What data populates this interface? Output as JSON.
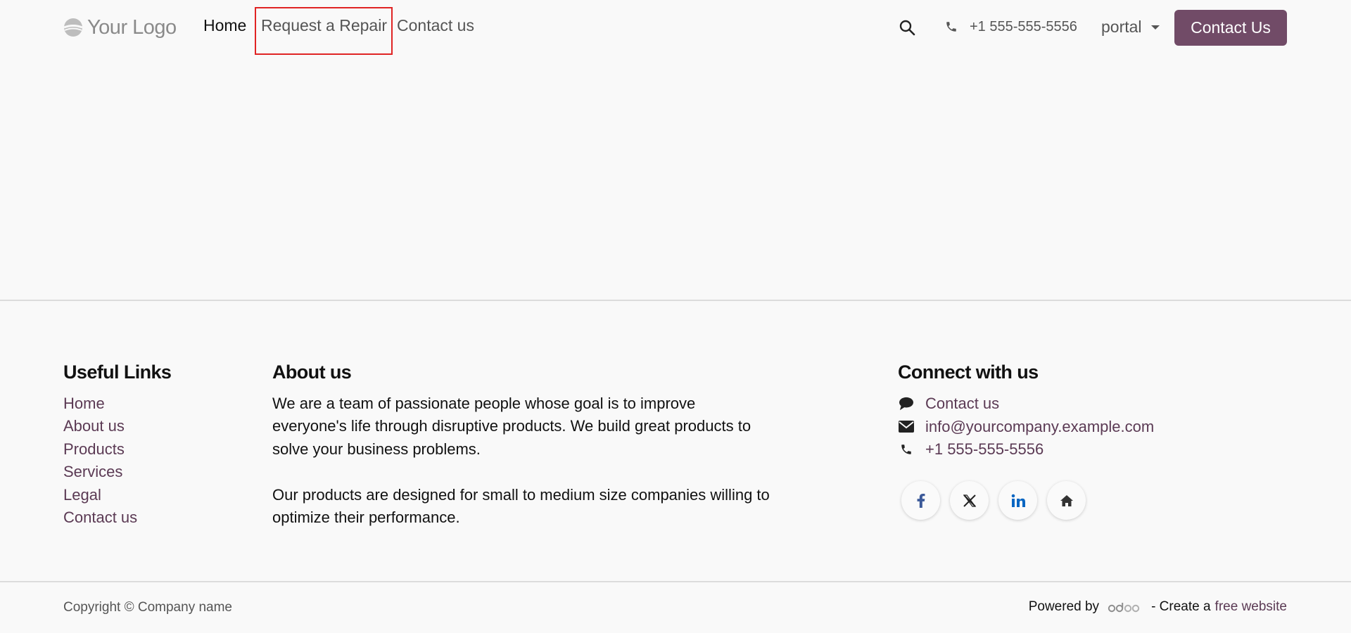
{
  "header": {
    "logo_text": "Your Logo",
    "nav": {
      "home": "Home",
      "request_repair": "Request a Repair",
      "contact": "Contact us"
    },
    "phone": "+1 555-555-5556",
    "user_menu": "portal",
    "cta_button": "Contact Us"
  },
  "footer": {
    "useful_links": {
      "title": "Useful Links",
      "items": [
        "Home",
        "About us",
        "Products",
        "Services",
        "Legal",
        "Contact us"
      ]
    },
    "about": {
      "title": "About us",
      "paragraph1": "We are a team of passionate people whose goal is to improve everyone's life through disruptive products. We build great products to solve your business problems.",
      "paragraph2": "Our products are designed for small to medium size companies willing to optimize their performance."
    },
    "connect": {
      "title": "Connect with us",
      "contact_link": "Contact us",
      "email": "info@yourcompany.example.com",
      "phone": "+1 555-555-5556",
      "social_icons": [
        "facebook-icon",
        "x-twitter-icon",
        "linkedin-icon",
        "home-icon"
      ]
    }
  },
  "bottom_bar": {
    "copyright": "Copyright © Company name",
    "powered_by": "Powered by",
    "create_text": "- Create a",
    "free_website": "free website"
  },
  "colors": {
    "brand": "#714b67",
    "link": "#5b3a54",
    "highlight": "#e02424"
  }
}
